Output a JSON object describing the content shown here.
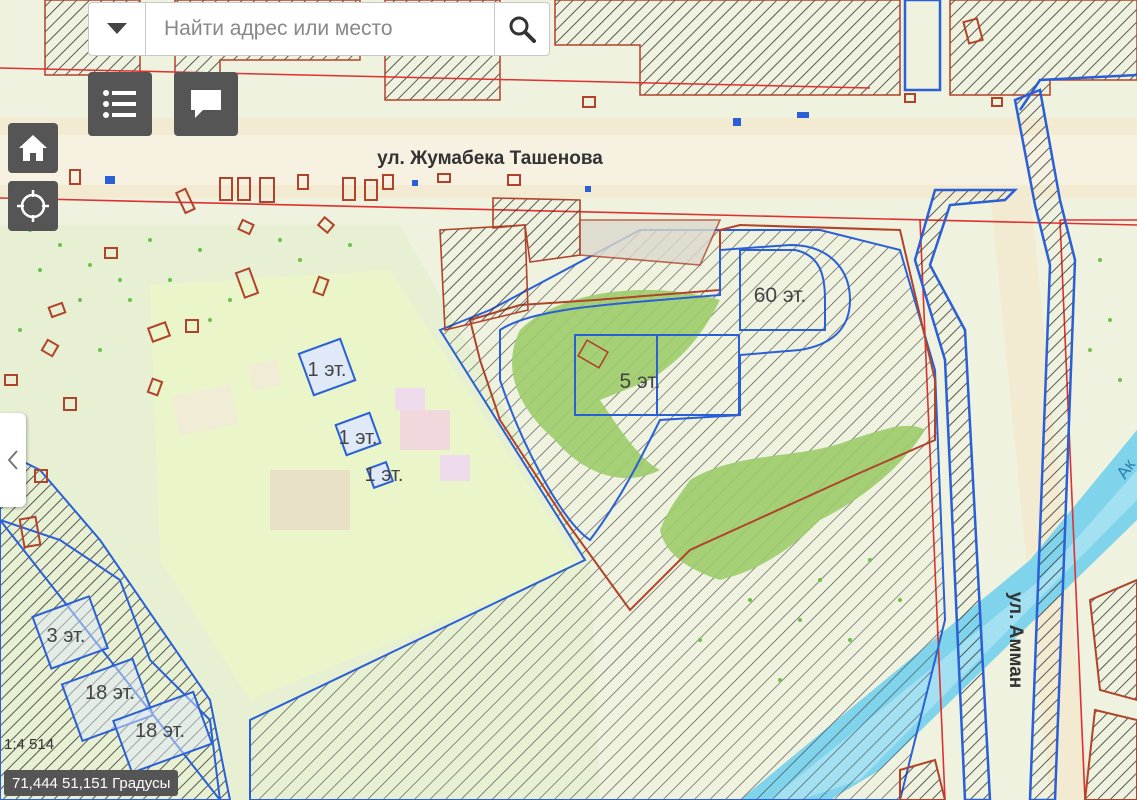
{
  "search": {
    "placeholder": "Найти адрес или место"
  },
  "map": {
    "street_tashenov": "ул. Жумабека Ташенова",
    "street_amman": "ул. Амман",
    "river_label": "Ак",
    "labels": {
      "floors_60": "60 эт.",
      "floors_5": "5 эт.",
      "floors_1a": "1 эт.",
      "floors_1b": "1 эт.",
      "floors_1c": "1 эт.",
      "floors_3": "3 эт.",
      "floors_18a": "18 эт.",
      "floors_18b": "18 эт."
    }
  },
  "status": {
    "scale": "1:4 514",
    "coordinates": "71,444 51,151 Градусы"
  },
  "colors": {
    "parcel_red": "#b0432a",
    "boundary_blue": "#2a5fd6",
    "park_green": "#9ccc6a",
    "road": "#f4ead2",
    "river": "#6fd0ea"
  }
}
